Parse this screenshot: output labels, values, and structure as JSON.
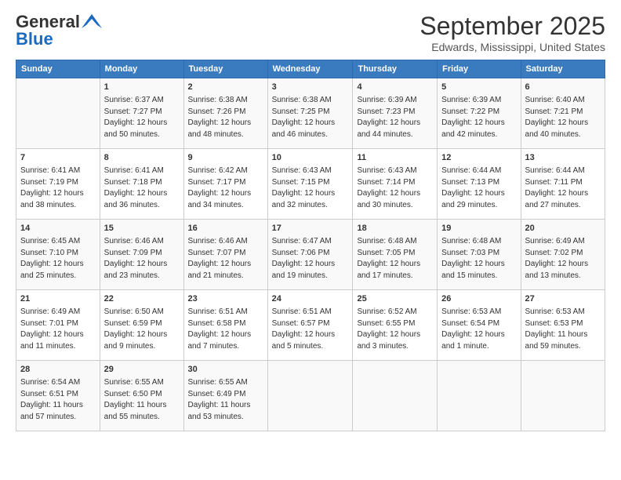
{
  "header": {
    "logo_general": "General",
    "logo_blue": "Blue",
    "month_title": "September 2025",
    "location": "Edwards, Mississippi, United States"
  },
  "calendar": {
    "days_of_week": [
      "Sunday",
      "Monday",
      "Tuesday",
      "Wednesday",
      "Thursday",
      "Friday",
      "Saturday"
    ],
    "weeks": [
      [
        {
          "day": "",
          "info": ""
        },
        {
          "day": "1",
          "info": "Sunrise: 6:37 AM\nSunset: 7:27 PM\nDaylight: 12 hours\nand 50 minutes."
        },
        {
          "day": "2",
          "info": "Sunrise: 6:38 AM\nSunset: 7:26 PM\nDaylight: 12 hours\nand 48 minutes."
        },
        {
          "day": "3",
          "info": "Sunrise: 6:38 AM\nSunset: 7:25 PM\nDaylight: 12 hours\nand 46 minutes."
        },
        {
          "day": "4",
          "info": "Sunrise: 6:39 AM\nSunset: 7:23 PM\nDaylight: 12 hours\nand 44 minutes."
        },
        {
          "day": "5",
          "info": "Sunrise: 6:39 AM\nSunset: 7:22 PM\nDaylight: 12 hours\nand 42 minutes."
        },
        {
          "day": "6",
          "info": "Sunrise: 6:40 AM\nSunset: 7:21 PM\nDaylight: 12 hours\nand 40 minutes."
        }
      ],
      [
        {
          "day": "7",
          "info": "Sunrise: 6:41 AM\nSunset: 7:19 PM\nDaylight: 12 hours\nand 38 minutes."
        },
        {
          "day": "8",
          "info": "Sunrise: 6:41 AM\nSunset: 7:18 PM\nDaylight: 12 hours\nand 36 minutes."
        },
        {
          "day": "9",
          "info": "Sunrise: 6:42 AM\nSunset: 7:17 PM\nDaylight: 12 hours\nand 34 minutes."
        },
        {
          "day": "10",
          "info": "Sunrise: 6:43 AM\nSunset: 7:15 PM\nDaylight: 12 hours\nand 32 minutes."
        },
        {
          "day": "11",
          "info": "Sunrise: 6:43 AM\nSunset: 7:14 PM\nDaylight: 12 hours\nand 30 minutes."
        },
        {
          "day": "12",
          "info": "Sunrise: 6:44 AM\nSunset: 7:13 PM\nDaylight: 12 hours\nand 29 minutes."
        },
        {
          "day": "13",
          "info": "Sunrise: 6:44 AM\nSunset: 7:11 PM\nDaylight: 12 hours\nand 27 minutes."
        }
      ],
      [
        {
          "day": "14",
          "info": "Sunrise: 6:45 AM\nSunset: 7:10 PM\nDaylight: 12 hours\nand 25 minutes."
        },
        {
          "day": "15",
          "info": "Sunrise: 6:46 AM\nSunset: 7:09 PM\nDaylight: 12 hours\nand 23 minutes."
        },
        {
          "day": "16",
          "info": "Sunrise: 6:46 AM\nSunset: 7:07 PM\nDaylight: 12 hours\nand 21 minutes."
        },
        {
          "day": "17",
          "info": "Sunrise: 6:47 AM\nSunset: 7:06 PM\nDaylight: 12 hours\nand 19 minutes."
        },
        {
          "day": "18",
          "info": "Sunrise: 6:48 AM\nSunset: 7:05 PM\nDaylight: 12 hours\nand 17 minutes."
        },
        {
          "day": "19",
          "info": "Sunrise: 6:48 AM\nSunset: 7:03 PM\nDaylight: 12 hours\nand 15 minutes."
        },
        {
          "day": "20",
          "info": "Sunrise: 6:49 AM\nSunset: 7:02 PM\nDaylight: 12 hours\nand 13 minutes."
        }
      ],
      [
        {
          "day": "21",
          "info": "Sunrise: 6:49 AM\nSunset: 7:01 PM\nDaylight: 12 hours\nand 11 minutes."
        },
        {
          "day": "22",
          "info": "Sunrise: 6:50 AM\nSunset: 6:59 PM\nDaylight: 12 hours\nand 9 minutes."
        },
        {
          "day": "23",
          "info": "Sunrise: 6:51 AM\nSunset: 6:58 PM\nDaylight: 12 hours\nand 7 minutes."
        },
        {
          "day": "24",
          "info": "Sunrise: 6:51 AM\nSunset: 6:57 PM\nDaylight: 12 hours\nand 5 minutes."
        },
        {
          "day": "25",
          "info": "Sunrise: 6:52 AM\nSunset: 6:55 PM\nDaylight: 12 hours\nand 3 minutes."
        },
        {
          "day": "26",
          "info": "Sunrise: 6:53 AM\nSunset: 6:54 PM\nDaylight: 12 hours\nand 1 minute."
        },
        {
          "day": "27",
          "info": "Sunrise: 6:53 AM\nSunset: 6:53 PM\nDaylight: 11 hours\nand 59 minutes."
        }
      ],
      [
        {
          "day": "28",
          "info": "Sunrise: 6:54 AM\nSunset: 6:51 PM\nDaylight: 11 hours\nand 57 minutes."
        },
        {
          "day": "29",
          "info": "Sunrise: 6:55 AM\nSunset: 6:50 PM\nDaylight: 11 hours\nand 55 minutes."
        },
        {
          "day": "30",
          "info": "Sunrise: 6:55 AM\nSunset: 6:49 PM\nDaylight: 11 hours\nand 53 minutes."
        },
        {
          "day": "",
          "info": ""
        },
        {
          "day": "",
          "info": ""
        },
        {
          "day": "",
          "info": ""
        },
        {
          "day": "",
          "info": ""
        }
      ]
    ]
  }
}
